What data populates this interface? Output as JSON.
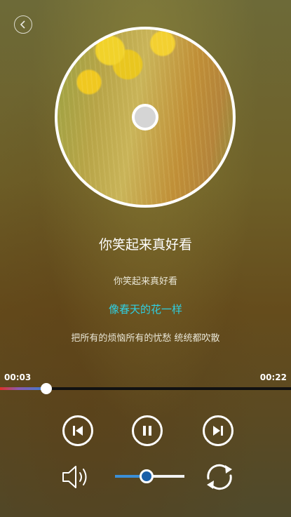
{
  "header": {
    "back_icon": "chevron-left-icon"
  },
  "album": {
    "cover": "dandelion-flowers-album-cover"
  },
  "song": {
    "title": "你笑起来真好看"
  },
  "lyrics": [
    {
      "text": "你笑起来真好看",
      "state": "past"
    },
    {
      "text": "像春天的花一样",
      "state": "current"
    },
    {
      "text": "把所有的烦恼所有的忧愁 统统都吹散",
      "state": "upcoming"
    }
  ],
  "playback": {
    "current_time": "00:03",
    "duration": "00:22",
    "progress_fraction": 0.16,
    "state": "playing"
  },
  "controls": {
    "prev_icon": "skip-previous-icon",
    "pause_icon": "pause-icon",
    "next_icon": "skip-next-icon",
    "volume_icon": "speaker-icon",
    "loop_icon": "repeat-icon"
  },
  "volume": {
    "level_fraction": 0.45
  },
  "colors": {
    "active_lyric": "#2fd0e3",
    "progress_start": "#e0312a",
    "progress_end": "#3a7fd0",
    "volume_fill": "#3b8fd6"
  }
}
